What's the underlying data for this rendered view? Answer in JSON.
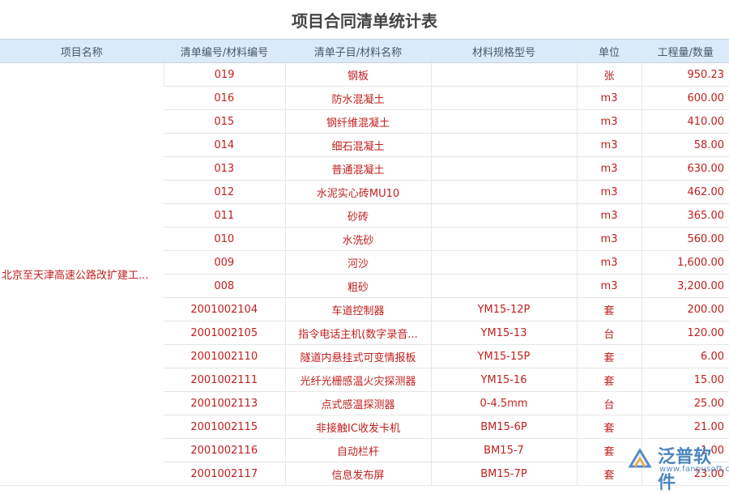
{
  "page": {
    "title": "项目合同清单统计表"
  },
  "table": {
    "headers": [
      "项目名称",
      "清单编号/材料编号",
      "清单子目/材料名称",
      "材料规格型号",
      "单位",
      "工程量/数量"
    ],
    "project_name": "北京至天津高速公路改扩建工...",
    "rows": [
      {
        "code": "019",
        "name": "钢板",
        "spec": "",
        "unit": "张",
        "qty": "950.23"
      },
      {
        "code": "016",
        "name": "防水混凝土",
        "spec": "",
        "unit": "m3",
        "qty": "600.00"
      },
      {
        "code": "015",
        "name": "钢纤维混凝土",
        "spec": "",
        "unit": "m3",
        "qty": "410.00"
      },
      {
        "code": "014",
        "name": "细石混凝土",
        "spec": "",
        "unit": "m3",
        "qty": "58.00"
      },
      {
        "code": "013",
        "name": "普通混凝土",
        "spec": "",
        "unit": "m3",
        "qty": "630.00"
      },
      {
        "code": "012",
        "name": "水泥实心砖MU10",
        "spec": "",
        "unit": "m3",
        "qty": "462.00"
      },
      {
        "code": "011",
        "name": "砂砖",
        "spec": "",
        "unit": "m3",
        "qty": "365.00"
      },
      {
        "code": "010",
        "name": "水洗砂",
        "spec": "",
        "unit": "m3",
        "qty": "560.00"
      },
      {
        "code": "009",
        "name": "河沙",
        "spec": "",
        "unit": "m3",
        "qty": "1,600.00"
      },
      {
        "code": "008",
        "name": "粗砂",
        "spec": "",
        "unit": "m3",
        "qty": "3,200.00"
      },
      {
        "code": "2001002104",
        "name": "车道控制器",
        "spec": "YM15-12P",
        "unit": "套",
        "qty": "200.00"
      },
      {
        "code": "2001002105",
        "name": "指令电话主机(数字录音...",
        "spec": "YM15-13",
        "unit": "台",
        "qty": "120.00"
      },
      {
        "code": "2001002110",
        "name": "隧道内悬挂式可变情报板",
        "spec": "YM15-15P",
        "unit": "套",
        "qty": "6.00"
      },
      {
        "code": "2001002111",
        "name": "光纤光栅感温火灾探测器",
        "spec": "YM15-16",
        "unit": "套",
        "qty": "15.00"
      },
      {
        "code": "2001002113",
        "name": "点式感温探测器",
        "spec": "0-4.5mm",
        "unit": "台",
        "qty": "25.00"
      },
      {
        "code": "2001002115",
        "name": "非接触IC收发卡机",
        "spec": "BM15-6P",
        "unit": "套",
        "qty": "21.00"
      },
      {
        "code": "2001002116",
        "name": "自动栏杆",
        "spec": "BM15-7",
        "unit": "套",
        "qty": "1.00"
      },
      {
        "code": "2001002117",
        "name": "信息发布屏",
        "spec": "BM15-7P",
        "unit": "套",
        "qty": "23.00"
      }
    ]
  },
  "watermark": {
    "brand": "泛普软件",
    "url": "www.fanpusoft.com",
    "color": "#3a7ab8"
  }
}
